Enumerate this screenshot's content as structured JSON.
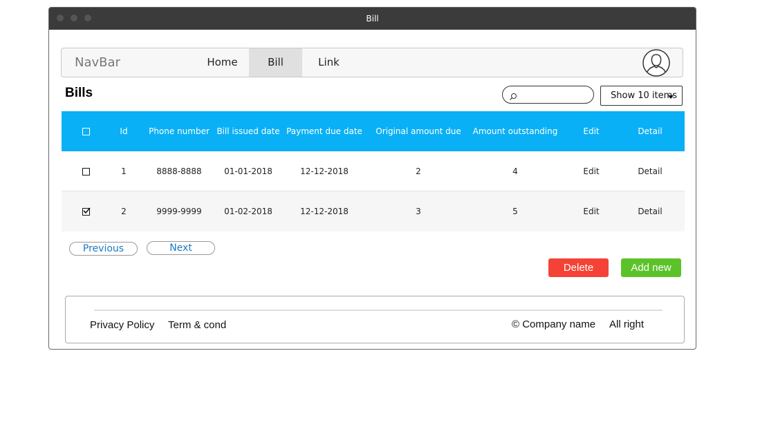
{
  "window": {
    "title": "Bill"
  },
  "navbar": {
    "brand": "NavBar",
    "links": [
      {
        "label": "Home",
        "active": false
      },
      {
        "label": "Bill",
        "active": true
      },
      {
        "label": "Link",
        "active": false
      }
    ],
    "avatar_icon": "user-avatar-icon"
  },
  "page": {
    "title": "Bills"
  },
  "search": {
    "value": "",
    "placeholder": "",
    "icon": "search-icon"
  },
  "show_select": {
    "label": "Show 10 items",
    "icon": "caret-down-icon"
  },
  "table": {
    "columns": [
      "Id",
      "Phone number",
      "Bill issued date",
      "Payment due date",
      "Original amount due",
      "Amount outstanding",
      "Edit",
      "Detail"
    ],
    "header_checked": false,
    "rows": [
      {
        "checked": false,
        "id": "1",
        "phone": "8888-8888",
        "issued": "01-01-2018",
        "due": "12-12-2018",
        "original": "2",
        "outstanding": "4",
        "edit": "Edit",
        "detail": "Detail"
      },
      {
        "checked": true,
        "id": "2",
        "phone": "9999-9999",
        "issued": "01-02-2018",
        "due": "12-12-2018",
        "original": "3",
        "outstanding": "5",
        "edit": "Edit",
        "detail": "Detail"
      }
    ]
  },
  "pagination": {
    "previous": "Previous",
    "next": "Next"
  },
  "actions": {
    "delete": "Delete",
    "add_new": "Add new"
  },
  "footer": {
    "privacy": "Privacy Policy",
    "terms": "Term & cond",
    "company": "© Company name",
    "rights": "All right"
  },
  "colors": {
    "header_blue": "#0ab0f5",
    "delete_red": "#f44336",
    "add_green": "#5cc22a",
    "link_blue": "#1a7bc4"
  }
}
